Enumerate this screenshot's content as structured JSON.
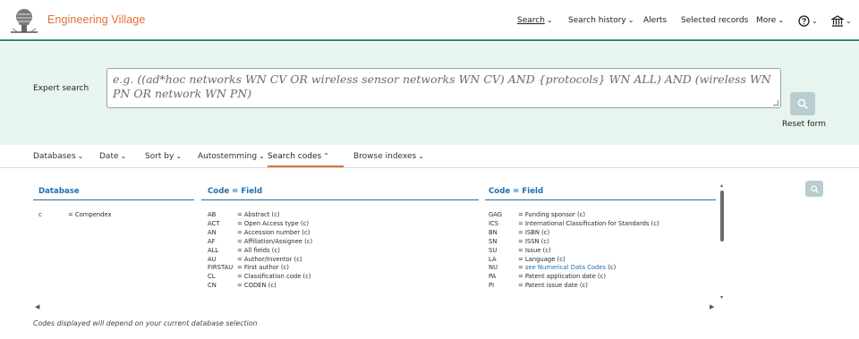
{
  "header": {
    "brand": "Engineering Village",
    "nav": [
      {
        "label": "Search",
        "chevron": true
      },
      {
        "label": "Search history",
        "chevron": true
      },
      {
        "label": "Alerts",
        "chevron": false
      },
      {
        "label": "Selected records",
        "chevron": false
      },
      {
        "label": "More",
        "chevron": true
      }
    ],
    "help_icon": "question-circle-icon",
    "institution_icon": "institution-icon"
  },
  "search": {
    "label": "Expert search",
    "placeholder": "e.g. ((ad*hoc networks WN CV OR wireless sensor networks WN CV) AND {protocols} WN ALL) AND (wireless WN PN OR network WN PN)",
    "reset_label": "Reset form",
    "accent": "#2a8c76",
    "background": "#e8f5ee"
  },
  "tabs": [
    {
      "label": "Databases",
      "state": "down"
    },
    {
      "label": "Date",
      "state": "down"
    },
    {
      "label": "Sort by",
      "state": "down"
    },
    {
      "label": "Autostemming",
      "state": "down"
    },
    {
      "label": "Search codes",
      "state": "up"
    },
    {
      "label": "Browse indexes",
      "state": "down"
    }
  ],
  "codes": {
    "headers": {
      "database": "Database",
      "code_field_1": "Code = Field",
      "code_field_2": "Code = Field"
    },
    "database_rows": [
      {
        "code": "c",
        "field": "= Compendex"
      }
    ],
    "col1": [
      {
        "code": "AB",
        "field": "= Abstract (c)"
      },
      {
        "code": "ACT",
        "field": "= Open Access type (c)"
      },
      {
        "code": "AN",
        "field": "= Accession number (c)"
      },
      {
        "code": "AF",
        "field": "= Affiliation/Assignee (c)"
      },
      {
        "code": "ALL",
        "field": "= All fields (c)"
      },
      {
        "code": "AU",
        "field": "= Author/Inventor (c)"
      },
      {
        "code": "FIRSTAU",
        "field": "= First author (c)"
      },
      {
        "code": "CL",
        "field": "= Classification code (c)"
      },
      {
        "code": "CN",
        "field": "= CODEN (c)"
      }
    ],
    "col2": [
      {
        "code": "GAG",
        "pre": "= Funding sponsor (c)",
        "link": "",
        "post": ""
      },
      {
        "code": "ICS",
        "pre": "= International Classification for Standards (c)",
        "link": "",
        "post": ""
      },
      {
        "code": "BN",
        "pre": "= ISBN (c)",
        "link": "",
        "post": ""
      },
      {
        "code": "SN",
        "pre": "= ISSN (c)",
        "link": "",
        "post": ""
      },
      {
        "code": "SU",
        "pre": "= Issue (c)",
        "link": "",
        "post": ""
      },
      {
        "code": "LA",
        "pre": "= Language (c)",
        "link": "",
        "post": ""
      },
      {
        "code": "NU",
        "pre": "= ",
        "link": "see Numerical Data Codes",
        "post": " (c)"
      },
      {
        "code": "PA",
        "pre": "= Patent application date (c)",
        "link": "",
        "post": ""
      },
      {
        "code": "PI",
        "pre": "= Patent issue date (c)",
        "link": "",
        "post": ""
      }
    ],
    "link_color": "#1e6fb0",
    "footnote": "Codes displayed will depend on your current database selection"
  }
}
